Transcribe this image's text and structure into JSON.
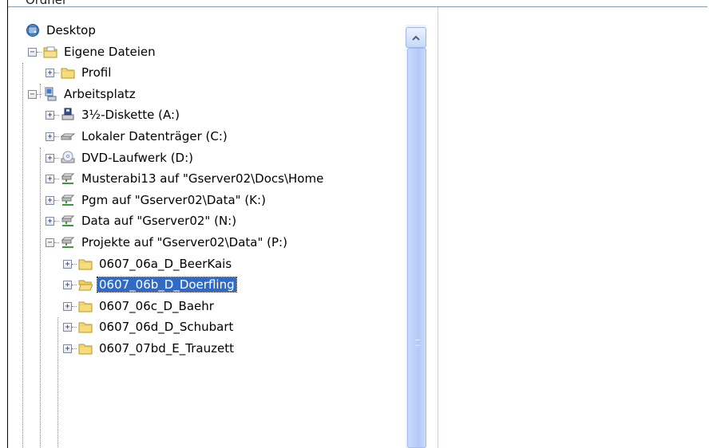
{
  "header": {
    "title": "Ordner"
  },
  "tree": {
    "items": [
      {
        "label": "Desktop",
        "icon": "desktop-icon",
        "level": 0,
        "expander": ""
      },
      {
        "label": "Eigene Dateien",
        "icon": "documents-folder-icon",
        "level": 1,
        "expander": "−"
      },
      {
        "label": "Profil",
        "icon": "folder-icon",
        "level": 2,
        "expander": "+"
      },
      {
        "label": "Arbeitsplatz",
        "icon": "computer-icon",
        "level": 1,
        "expander": "−"
      },
      {
        "label": "3½-Diskette (A:)",
        "icon": "floppy-drive-icon",
        "level": 2,
        "expander": "+"
      },
      {
        "label": "Lokaler Datenträger (C:)",
        "icon": "hard-drive-icon",
        "level": 2,
        "expander": "+"
      },
      {
        "label": "DVD-Laufwerk (D:)",
        "icon": "dvd-drive-icon",
        "level": 2,
        "expander": "+"
      },
      {
        "label": "Musterabi13 auf \"Gserver02\\Docs\\Home",
        "icon": "network-drive-icon",
        "level": 2,
        "expander": "+"
      },
      {
        "label": "Pgm auf \"Gserver02\\Data\" (K:)",
        "icon": "network-drive-icon",
        "level": 2,
        "expander": "+"
      },
      {
        "label": "Data auf \"Gserver02\" (N:)",
        "icon": "network-drive-icon",
        "level": 2,
        "expander": "+"
      },
      {
        "label": "Projekte auf \"Gserver02\\Data\" (P:)",
        "icon": "network-drive-icon",
        "level": 2,
        "expander": "−"
      },
      {
        "label": "0607_06a_D_BeerKais",
        "icon": "folder-icon",
        "level": 3,
        "expander": "+"
      },
      {
        "label": "0607_06b_D_Doerfling",
        "icon": "folder-open-icon",
        "level": 3,
        "expander": "+",
        "selected": true
      },
      {
        "label": "0607_06c_D_Baehr",
        "icon": "folder-icon",
        "level": 3,
        "expander": "+"
      },
      {
        "label": "0607_06d_D_Schubart",
        "icon": "folder-icon",
        "level": 3,
        "expander": "+"
      },
      {
        "label": "0607_07bd_E_Trauzett",
        "icon": "folder-icon",
        "level": 3,
        "expander": "+"
      }
    ]
  },
  "scrollbar": {
    "up_arrow": "up-arrow-icon"
  },
  "colors": {
    "selection": "#316ac5",
    "scroll_thumb": "#b3c9f7"
  }
}
